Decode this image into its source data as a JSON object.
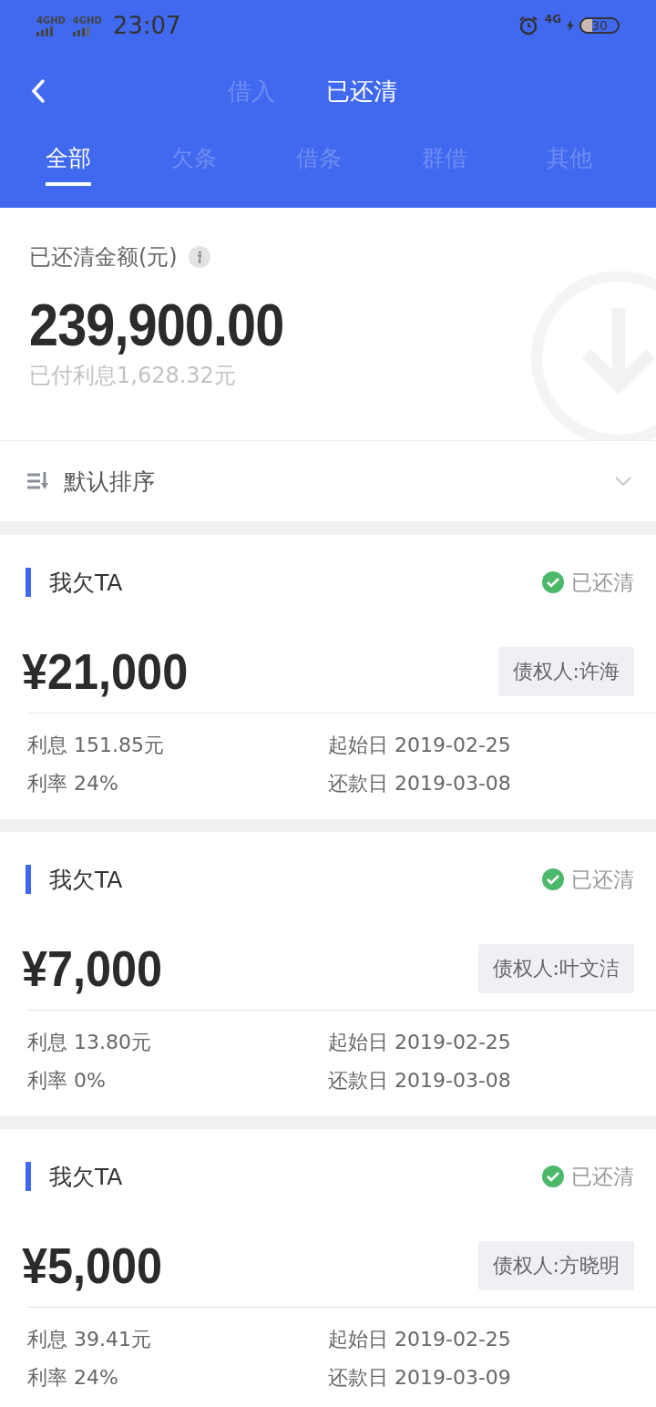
{
  "status_bar": {
    "network_1": "4GHD",
    "network_2": "4GHD",
    "time": "23:07",
    "network_3": "4G",
    "battery": "30"
  },
  "header": {
    "segments": [
      {
        "label": "借入",
        "selected": false
      },
      {
        "label": "已还清",
        "selected": true
      }
    ]
  },
  "tabs": [
    {
      "label": "全部",
      "selected": true
    },
    {
      "label": "欠条",
      "selected": false
    },
    {
      "label": "借条",
      "selected": false
    },
    {
      "label": "群借",
      "selected": false
    },
    {
      "label": "其他",
      "selected": false
    }
  ],
  "summary": {
    "label": "已还清金额(元)",
    "amount": "239,900.00",
    "interest": "已付利息1,628.32元"
  },
  "sort": {
    "label": "默认排序"
  },
  "loans": [
    {
      "title": "我欠TA",
      "status": "已还清",
      "amount": "¥21,000",
      "creditor": "债权人:许海",
      "interest": "利息 151.85元",
      "start": "起始日 2019-02-25",
      "rate": "利率 24%",
      "due": "还款日 2019-03-08"
    },
    {
      "title": "我欠TA",
      "status": "已还清",
      "amount": "¥7,000",
      "creditor": "债权人:叶文洁",
      "interest": "利息 13.80元",
      "start": "起始日 2019-02-25",
      "rate": "利率 0%",
      "due": "还款日 2019-03-08"
    },
    {
      "title": "我欠TA",
      "status": "已还清",
      "amount": "¥5,000",
      "creditor": "债权人:方晓明",
      "interest": "利息 39.41元",
      "start": "起始日 2019-02-25",
      "rate": "利率 24%",
      "due": "还款日 2019-03-09"
    }
  ]
}
